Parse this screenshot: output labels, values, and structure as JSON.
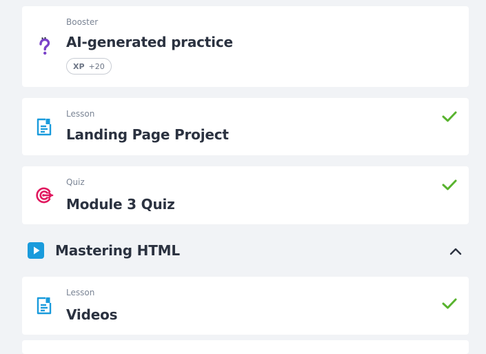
{
  "items": [
    {
      "kind": "Booster",
      "title": "AI-generated practice",
      "icon": "question-mark-icon",
      "xp_label": "XP",
      "xp_value": "+20",
      "completed": false
    },
    {
      "kind": "Lesson",
      "title": "Landing Page Project",
      "icon": "document-icon",
      "completed": true
    },
    {
      "kind": "Quiz",
      "title": "Module 3 Quiz",
      "icon": "target-icon",
      "completed": true
    }
  ],
  "section": {
    "title": "Mastering HTML",
    "icon": "play-icon",
    "expanded": true
  },
  "section_items": [
    {
      "kind": "Lesson",
      "title": "Videos",
      "icon": "document-icon",
      "completed": true
    }
  ],
  "colors": {
    "check": "#58b32e",
    "lesson_icon": "#1a9bdc",
    "quiz_icon": "#e0175e",
    "booster_icon": "#7a42c9",
    "play_icon": "#1a9bdc"
  }
}
